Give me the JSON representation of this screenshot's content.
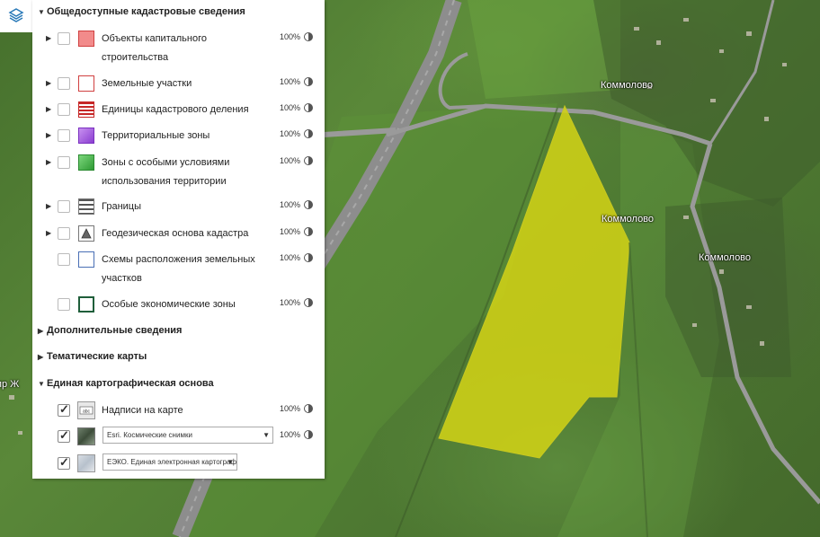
{
  "map": {
    "labels": [
      "Коммолово",
      "Коммолово",
      "Коммолово",
      "пр Ж"
    ]
  },
  "layers_toggle_icon": "layers-icon",
  "panel": {
    "groups": [
      {
        "title": "Общедоступные кадастровые сведения",
        "expanded": true
      },
      {
        "title": "Дополнительные сведения",
        "expanded": false
      },
      {
        "title": "Тематические карты",
        "expanded": false
      },
      {
        "title": "Единая картографическая основа",
        "expanded": true
      }
    ],
    "cadastral_layers": [
      {
        "label": "Объекты капитального строительства",
        "opacity": "100%",
        "checked": false,
        "icon": "capital-construction-icon",
        "color": "#f08080"
      },
      {
        "label": "Земельные участки",
        "opacity": "100%",
        "checked": false,
        "icon": "land-plots-icon",
        "color": "#e06060"
      },
      {
        "label": "Единицы кадастрового деления",
        "opacity": "100%",
        "checked": false,
        "icon": "cadastral-division-icon",
        "color": "#c62828"
      },
      {
        "label": "Территориальные зоны",
        "opacity": "100%",
        "checked": false,
        "icon": "territorial-zones-icon",
        "color": "#a050e0"
      },
      {
        "label": "Зоны с особыми условиями использования территории",
        "opacity": "100%",
        "checked": false,
        "icon": "special-zones-icon",
        "color": "#3cb043"
      },
      {
        "label": "Границы",
        "opacity": "100%",
        "checked": false,
        "icon": "borders-icon",
        "color": "#555555"
      },
      {
        "label": "Геодезическая основа кадастра",
        "opacity": "100%",
        "checked": false,
        "icon": "geodetic-icon",
        "color": "#555555"
      },
      {
        "label": "Схемы расположения земельных участков",
        "opacity": "100%",
        "checked": false,
        "icon": "plot-schemes-icon",
        "color": "#4a6fb5"
      },
      {
        "label": "Особые экономические зоны",
        "opacity": "100%",
        "checked": false,
        "icon": "economic-zones-icon",
        "color": "#1f5e3a"
      }
    ],
    "basemap_layers": [
      {
        "label": "Надписи на карте",
        "opacity": "100%",
        "checked": true,
        "icon": "map-labels-icon"
      },
      {
        "select_value": "Esri. Космические снимки",
        "opacity": "100%",
        "checked": true,
        "icon": "satellite-icon"
      },
      {
        "select_value": "ЕЭКО. Единая электронная картографичес",
        "checked": true,
        "icon": "eeko-map-icon"
      }
    ]
  },
  "colors": {
    "parcel_fill": "#d4d415",
    "road": "#8a8a8a"
  }
}
